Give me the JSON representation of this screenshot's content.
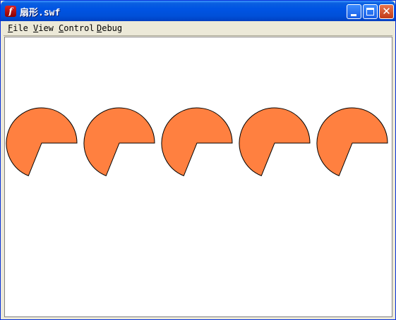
{
  "window": {
    "title": "扇形.swf",
    "app_icon_glyph": "f",
    "buttons": {
      "minimize": "minimize-icon",
      "maximize": "maximize-icon",
      "close": "close-icon"
    }
  },
  "menu": [
    {
      "label": "File",
      "accel": "F",
      "rest": "ile"
    },
    {
      "label": "View",
      "accel": "V",
      "rest": "iew"
    },
    {
      "label": "Control",
      "accel": "C",
      "rest": "ontrol"
    },
    {
      "label": "Debug",
      "accel": "D",
      "rest": "ebug"
    }
  ],
  "stage": {
    "background": "#ffffff",
    "sector_fill": "#ff8040",
    "sector_stroke": "#000000",
    "sector_count": 5
  }
}
